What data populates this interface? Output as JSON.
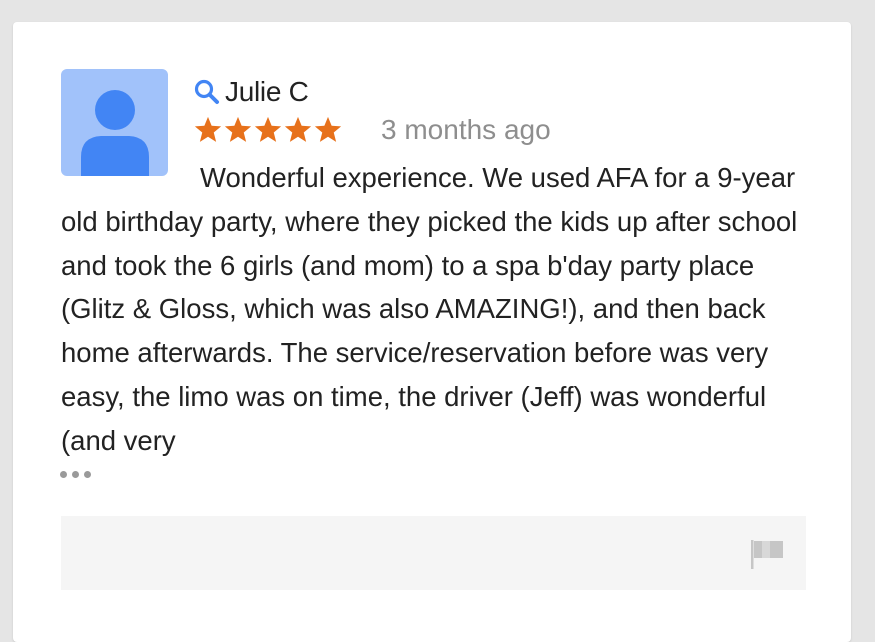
{
  "review": {
    "reviewer_name": "Julie C",
    "rating": 5,
    "rating_max": 5,
    "star_color": "#e7711b",
    "timestamp": "3 months ago",
    "text": "Wonderful experience. We used AFA for a 9-year old birthday party, where they picked the kids up after school and took the 6 girls (and mom) to a spa b'day party place (Glitz & Gloss, which was also AMAZING!), and then back home afterwards. The service/reservation before was very easy, the limo was on time, the driver (Jeff) was wonderful (and very",
    "more_indicator": "more-dots-icon",
    "avatar_icon": "default-avatar-icon",
    "reviewer_icon": "search-icon",
    "flag_icon": "flag-icon"
  },
  "colors": {
    "avatar_bg": "#a1c2fa",
    "avatar_figure": "#4285f4",
    "search_icon": "#4285f4",
    "flag": "#c6c6c6",
    "footer_bg": "#f5f5f5"
  }
}
